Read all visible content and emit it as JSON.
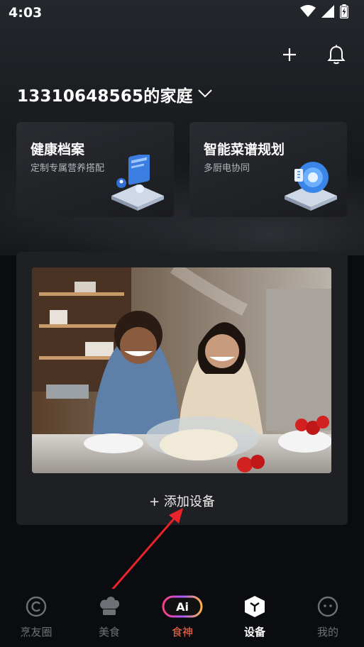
{
  "status_bar": {
    "time": "4:03"
  },
  "header": {
    "family_name": "13310648565的家庭"
  },
  "cards": [
    {
      "title": "健康档案",
      "subtitle": "定制专属营养搭配"
    },
    {
      "title": "智能菜谱规划",
      "subtitle": "多厨电协同"
    }
  ],
  "device_panel": {
    "add_label": "+ 添加设备"
  },
  "tabbar": {
    "items": [
      {
        "label": "烹友圈",
        "icon": "circle-c-icon"
      },
      {
        "label": "美食",
        "icon": "chef-hat-icon"
      },
      {
        "label": "食神",
        "icon": "ai-badge-icon",
        "badge_text": "Ai"
      },
      {
        "label": "设备",
        "icon": "device-cube-icon"
      },
      {
        "label": "我的",
        "icon": "profile-face-icon"
      }
    ],
    "active": "设备"
  },
  "colors": {
    "background": "#0b0c0f",
    "card": "#1f2023",
    "ai_label": "#ff6b4a"
  }
}
